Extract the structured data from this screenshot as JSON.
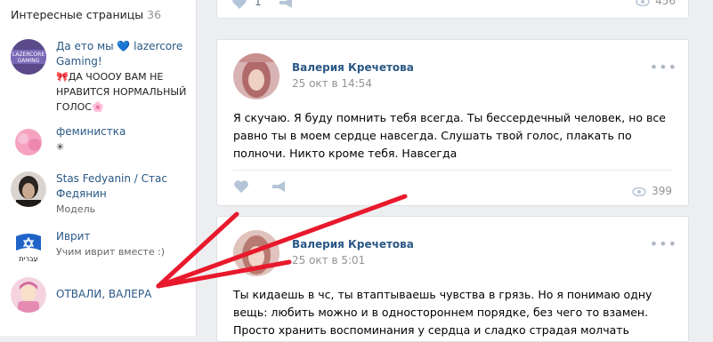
{
  "sidebar": {
    "title": "Интересные страницы",
    "count": "36",
    "items": [
      {
        "name": "Да ето мы 💙 lazercore Gaming!",
        "desc": "🎀ДА ЧОООУ ВАМ НЕ НРАВИТСЯ НОРМАЛЬНЫЙ ГОЛОС🌸"
      },
      {
        "name": "феминистка",
        "desc": "✳"
      },
      {
        "name": "Stas Fedyanin / Стас Федянин",
        "desc": "Модель"
      },
      {
        "name": "Иврит",
        "desc": "Учим иврит вместе :)"
      },
      {
        "name": "ОТВАЛИ, ВАЛЕРА",
        "desc": ""
      }
    ]
  },
  "top_card": {
    "likes": "1",
    "views": "456"
  },
  "posts": [
    {
      "author": "Валерия Кречетова",
      "date": "25 окт в 14:54",
      "text": "Я скучаю. Я буду помнить тебя всегда. Ты бессердечный человек, но все равно ты в моем сердце навсегда. Слушать твой голос, плакать по полночи. Никто кроме тебя. Навсегда",
      "views": "399"
    },
    {
      "author": "Валерия Кречетова",
      "date": "25 окт в 5:01",
      "text": "Ты кидаешь в чс, ты втаптываешь чувства в грязь. Но я понимаю одну вещь: любить можно и в одностороннем порядке, без чего то взамен. Просто хранить воспоминания у сердца и сладко страдая молчать"
    }
  ],
  "colors": {
    "link": "#2a5885",
    "arrow": "#e8192c",
    "muted": "#939393",
    "bg": "#edeef0"
  }
}
